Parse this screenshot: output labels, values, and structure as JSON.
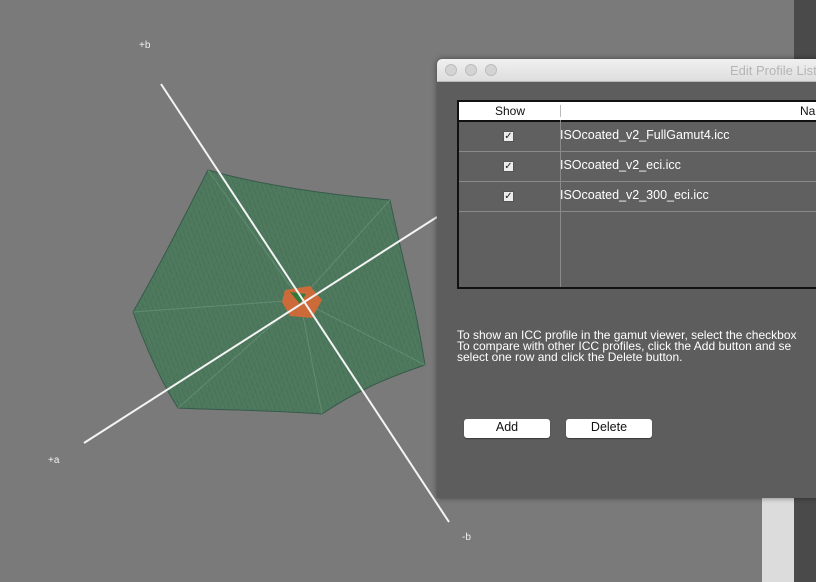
{
  "viewer": {
    "axis_labels": {
      "plus_b": "+b",
      "plus_a": "+a",
      "minus_b": "-b"
    },
    "colors": {
      "background": "#7a7a7a",
      "gamut_fill": "#4f7a5e",
      "gamut_mesh": "#3f6a52",
      "axis": "#f4f4f4",
      "inner": "#cc6a3a"
    }
  },
  "dialog": {
    "title": "Edit Profile List",
    "table": {
      "headers": {
        "show": "Show",
        "name": "Name"
      },
      "rows": [
        {
          "checked": true,
          "name": "ISOcoated_v2_FullGamut4.icc"
        },
        {
          "checked": true,
          "name": "ISOcoated_v2_eci.icc"
        },
        {
          "checked": true,
          "name": "ISOcoated_v2_300_eci.icc"
        }
      ]
    },
    "instructions": [
      "To show an ICC profile in the gamut viewer, select the checkbox",
      "To compare with other ICC profiles, click the Add button and se",
      "select one row and click the Delete button."
    ],
    "buttons": {
      "add": "Add",
      "delete": "Delete"
    }
  },
  "icons": {
    "checkbox_mark": "✓"
  }
}
